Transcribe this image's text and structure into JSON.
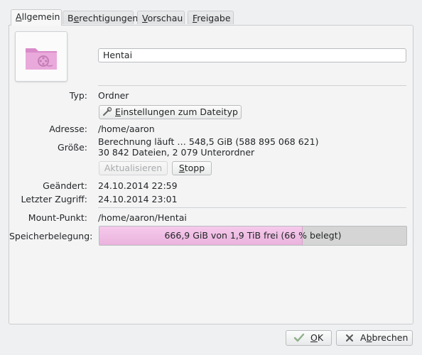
{
  "tabs": [
    {
      "label_pre": "",
      "mnemonic": "A",
      "label_post": "llgemein"
    },
    {
      "label_pre": "B",
      "mnemonic": "e",
      "label_post": "rechtigungen"
    },
    {
      "label_pre": "",
      "mnemonic": "V",
      "label_post": "orschau"
    },
    {
      "label_pre": "",
      "mnemonic": "F",
      "label_post": "reigabe"
    }
  ],
  "name": "Hentai",
  "type": {
    "label": "Typ:",
    "value": "Ordner",
    "button_mnemonic": "E",
    "button_rest": "instellungen zum Dateityp"
  },
  "address": {
    "label": "Adresse:",
    "value": "/home/aaron"
  },
  "size": {
    "label": "Größe:",
    "line1": "Berechnung läuft … 548,5 GiB (588 895 068 621)",
    "line2": "30 842 Dateien, 2 079 Unterordner"
  },
  "buttons": {
    "refresh": "Aktualisieren",
    "stop_mnemonic": "S",
    "stop_rest": "topp"
  },
  "modified": {
    "label": "Geändert:",
    "value": "24.10.2014 22:59"
  },
  "accessed": {
    "label": "Letzter Zugriff:",
    "value": "24.10.2014 23:01"
  },
  "mount": {
    "label": "Mount-Punkt:",
    "value": "/home/aaron/Hentai"
  },
  "usage": {
    "label": "Speicherbelegung:",
    "text": "666,9 GiB von 1,9 TiB frei (66 % belegt)",
    "percent_used": 66
  },
  "dialog": {
    "ok_mnemonic": "O",
    "ok_rest": "K",
    "cancel_pre": "A",
    "cancel_mnemonic": "b",
    "cancel_rest": "brechen"
  },
  "colors": {
    "folder": "#e7a3d8",
    "usage_fill": "#f0bde6",
    "ok_check": "#8fb08a",
    "cancel_x": "#555555"
  },
  "icons": {
    "folder": "folder-video-icon",
    "settings": "wrench-icon",
    "ok": "check-icon",
    "cancel": "x-icon"
  }
}
